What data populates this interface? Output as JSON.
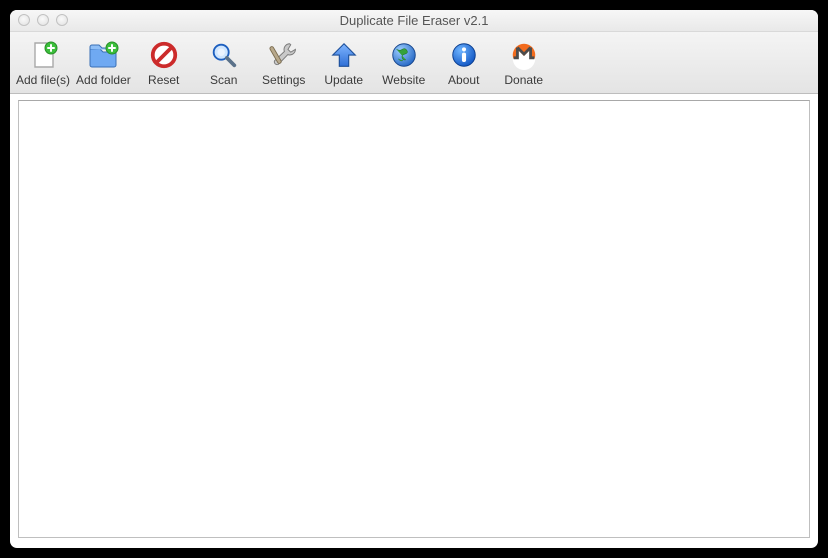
{
  "window": {
    "title": "Duplicate File Eraser v2.1"
  },
  "toolbar": {
    "items": [
      {
        "id": "add-files",
        "label": "Add file(s)",
        "icon": "file-add-icon"
      },
      {
        "id": "add-folder",
        "label": "Add folder",
        "icon": "folder-add-icon"
      },
      {
        "id": "reset",
        "label": "Reset",
        "icon": "no-entry-icon"
      },
      {
        "id": "scan",
        "label": "Scan",
        "icon": "magnifier-icon"
      },
      {
        "id": "settings",
        "label": "Settings",
        "icon": "tools-icon"
      },
      {
        "id": "update",
        "label": "Update",
        "icon": "arrow-up-icon"
      },
      {
        "id": "website",
        "label": "Website",
        "icon": "globe-icon"
      },
      {
        "id": "about",
        "label": "About",
        "icon": "info-icon"
      },
      {
        "id": "donate",
        "label": "Donate",
        "icon": "monero-icon"
      }
    ]
  },
  "colors": {
    "accent_green": "#3bbf3b",
    "accent_blue": "#2f6fd6",
    "accent_red": "#cc2b2b",
    "accent_orange": "#f26b1d"
  }
}
